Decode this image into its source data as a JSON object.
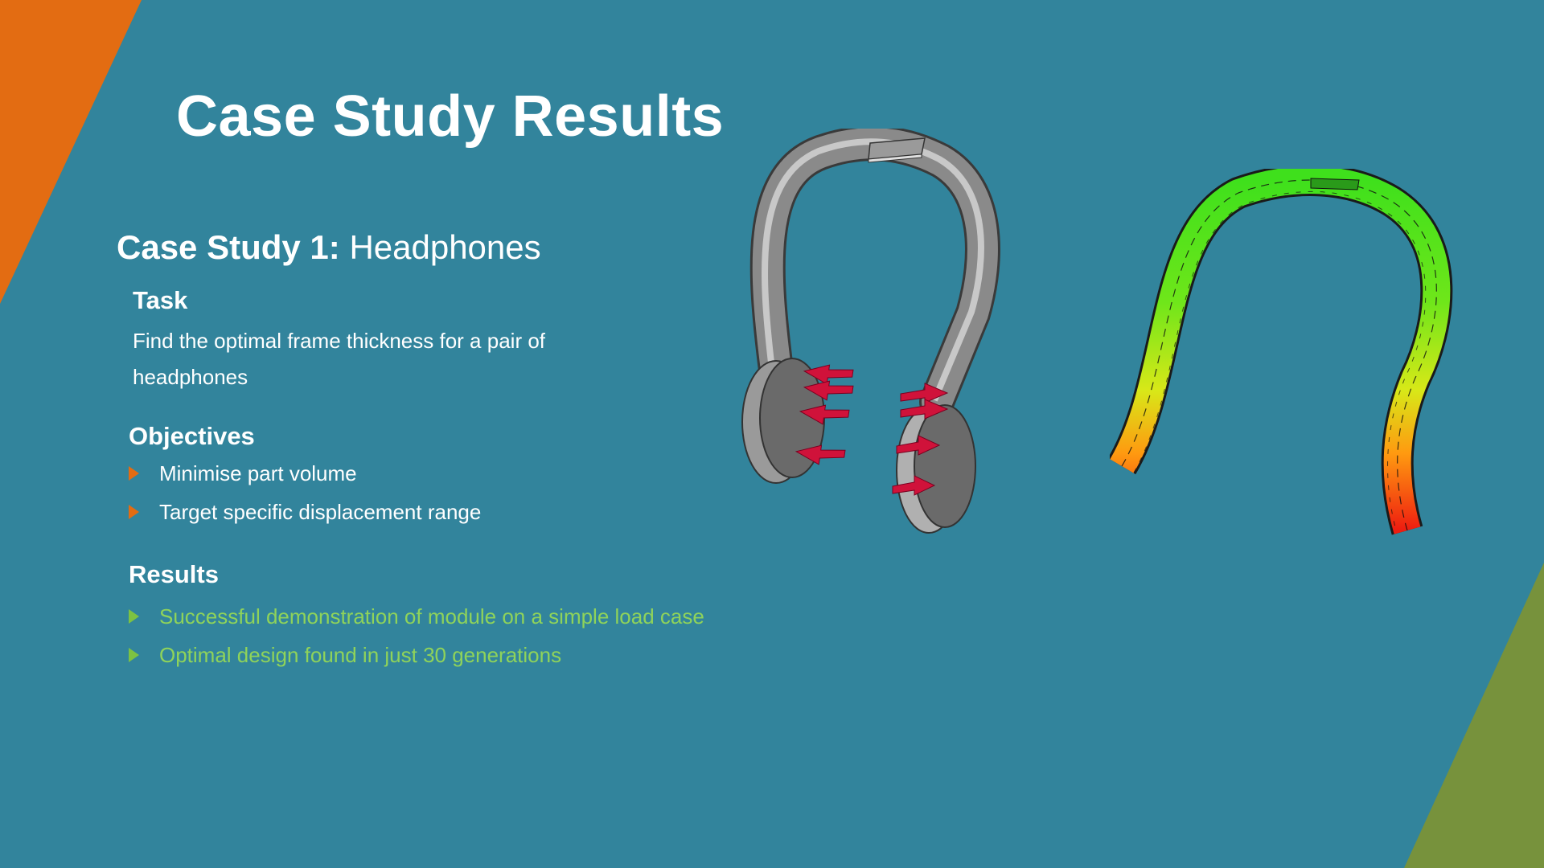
{
  "slide": {
    "title": "Case Study Results",
    "case_study": {
      "label": "Case Study 1:",
      "name": "Headphones"
    },
    "task": {
      "heading": "Task",
      "text": "Find the optimal frame thickness for a pair of headphones"
    },
    "objectives": {
      "heading": "Objectives",
      "items": [
        "Minimise part volume",
        "Target specific displacement range"
      ]
    },
    "results": {
      "heading": "Results",
      "items": [
        "Successful demonstration of module on a simple load case",
        "Optimal design found in just 30 generations"
      ]
    }
  },
  "colors": {
    "background": "#32849c",
    "accent_orange": "#e36c12",
    "accent_green": "#77923c",
    "results_text": "#8fd35a",
    "load_arrows": "#d0123a"
  },
  "images": {
    "left": "headphones-cad-model-with-load-arrows",
    "right": "headband-displacement-contour-mesh"
  }
}
